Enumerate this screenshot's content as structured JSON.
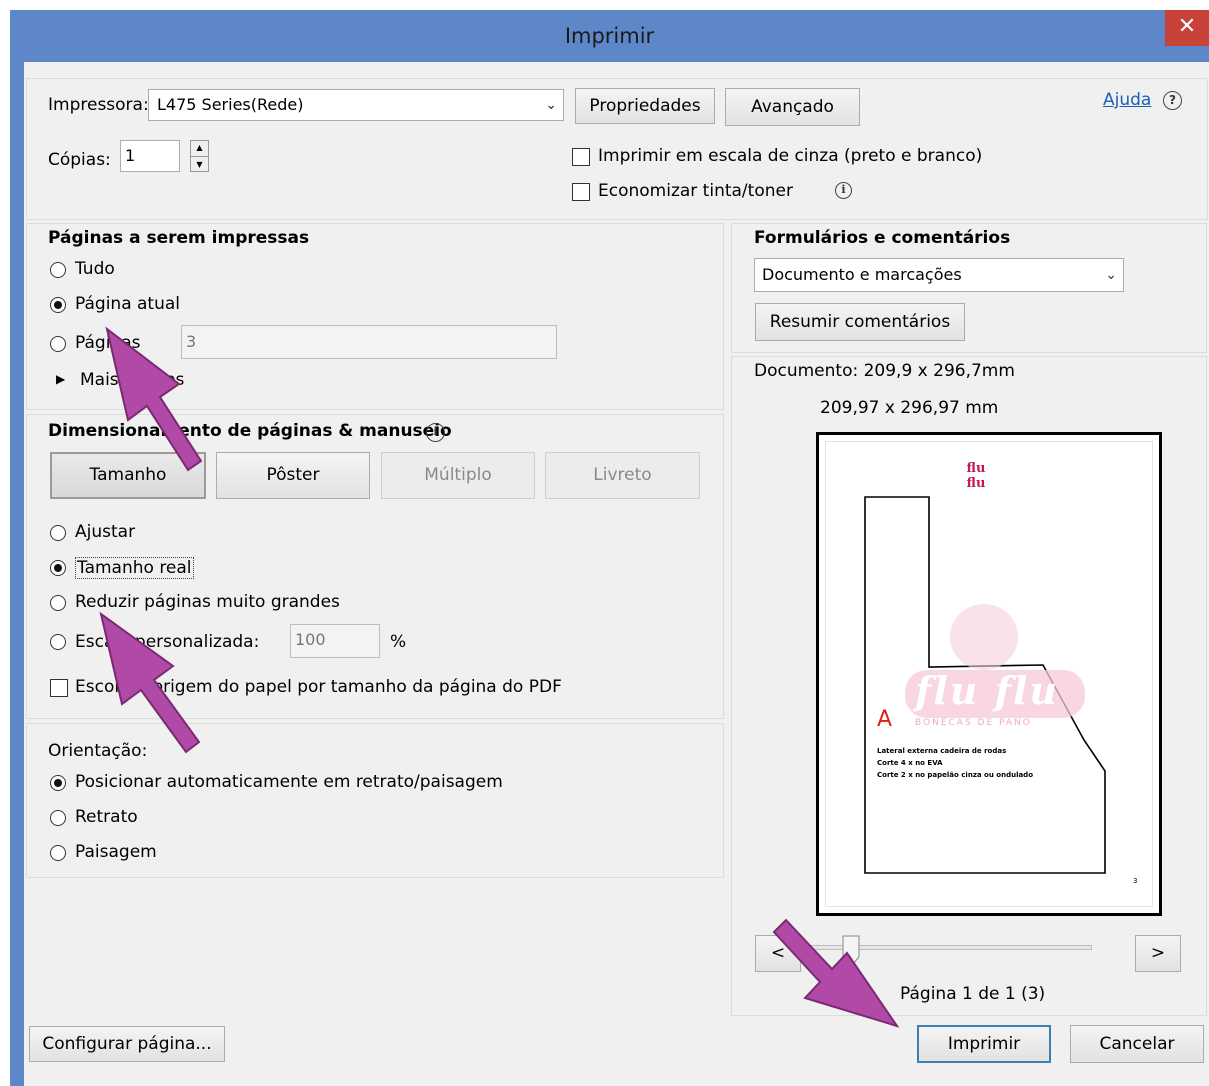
{
  "window": {
    "title": "Imprimir",
    "close_label": "✕"
  },
  "header": {
    "printer_label": "Impressora:",
    "printer_value": "L475 Series(Rede)",
    "properties_button": "Propriedades",
    "advanced_button": "Avançado",
    "help_link": "Ajuda",
    "help_icon": "?",
    "copies_label": "Cópias:",
    "copies_value": "1",
    "grayscale_label": "Imprimir em escala de cinza (preto e branco)",
    "grayscale_checked": false,
    "save_ink_label": "Economizar tinta/toner",
    "save_ink_checked": false,
    "info_glyph": "i"
  },
  "pages_section": {
    "title": "Páginas a serem impressas",
    "all_label": "Tudo",
    "current_label": "Página atual",
    "pages_label": "Páginas",
    "pages_value": "3",
    "more_options_label": "Mais opções",
    "selected": "current"
  },
  "sizing_section": {
    "title": "Dimensionamento de páginas & manuseio",
    "tabs": [
      "Tamanho",
      "Pôster",
      "Múltiplo",
      "Livreto"
    ],
    "selected_tab": "Tamanho",
    "fit_label": "Ajustar",
    "actual_label": "Tamanho real",
    "shrink_label": "Reduzir páginas muito grandes",
    "custom_label": "Escala personalizada:",
    "custom_value": "100",
    "percent": "%",
    "paper_source_label": "Escolher origem do papel por tamanho da página do PDF",
    "selected": "actual"
  },
  "orientation_section": {
    "title": "Orientação:",
    "auto_label": "Posicionar automaticamente em retrato/paisagem",
    "portrait_label": "Retrato",
    "landscape_label": "Paisagem",
    "selected": "auto"
  },
  "forms_section": {
    "title": "Formulários e comentários",
    "dropdown_value": "Documento e marcações",
    "summarize_button": "Resumir comentários"
  },
  "preview": {
    "document_size": "Documento: 209,9 x 296,7mm",
    "paper_size": "209,97 x 296,97 mm",
    "logo_text": "flu flu",
    "watermark_text": "flu flu",
    "watermark_sub": "BONECAS DE PANO",
    "piece_letter": "A",
    "piece_lines": [
      "Lateral externa cadeira de rodas",
      "Corte 4 x no EVA",
      "Corte 2 x no papelão cinza ou ondulado"
    ],
    "page_num": "3",
    "prev_label": "<",
    "next_label": ">",
    "slider_value": 0,
    "page_indicator": "Página 1 de 1 (3)"
  },
  "footer": {
    "page_setup_button": "Configurar página...",
    "print_button": "Imprimir",
    "cancel_button": "Cancelar"
  },
  "colors": {
    "titlebar": "#5d87c9",
    "close": "#c8423a",
    "arrow": "#b04aa6",
    "link": "#1a5fb4"
  }
}
